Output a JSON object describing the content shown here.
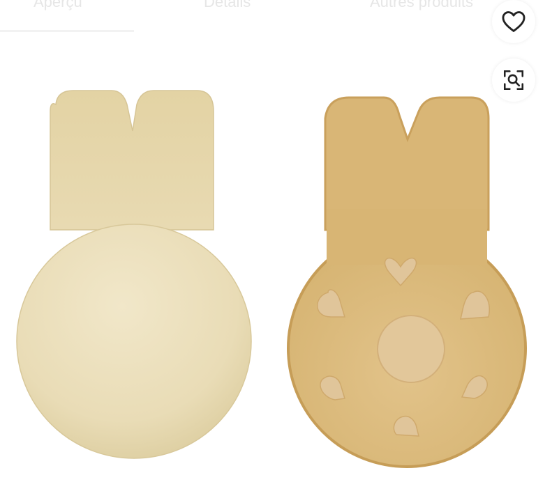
{
  "tabs": [
    {
      "label": "Aperçu"
    },
    {
      "label": "Détails"
    },
    {
      "label": "Autres produits"
    }
  ],
  "actions": {
    "favorite_icon": "heart-icon",
    "visual_search_icon": "image-search-icon"
  },
  "colors": {
    "background": "#ffffff",
    "outer_pad": "#e7dbb7",
    "inner_pad": "#d9b676",
    "icon": "#222222"
  }
}
